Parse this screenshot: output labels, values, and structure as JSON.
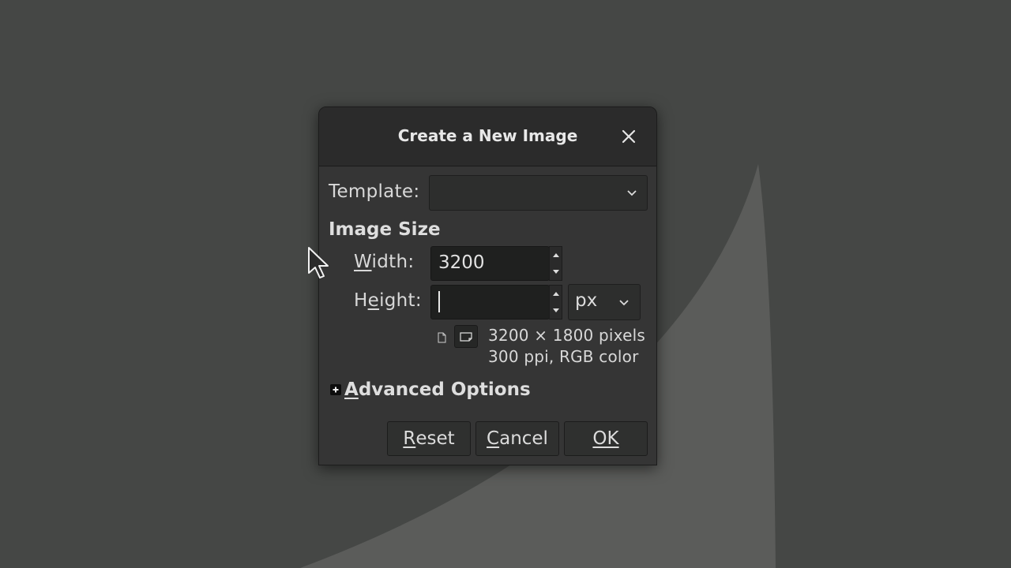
{
  "dialog": {
    "title": "Create a New Image",
    "template_label": "Template:",
    "template_value": "",
    "section_title": "Image Size",
    "width": {
      "label_first": "W",
      "label_rest": "idth:",
      "value": "3200"
    },
    "height": {
      "label_first": "H",
      "label_mid": "e",
      "label_rest": "ight:",
      "value": ""
    },
    "unit": "px",
    "info_line1": "3200 × 1800 pixels",
    "info_line2": "300 ppi, RGB color",
    "advanced": {
      "first": "A",
      "rest": "dvanced Options"
    },
    "buttons": {
      "reset": {
        "first": "R",
        "rest": "eset"
      },
      "cancel": {
        "first": "C",
        "rest": "ancel"
      },
      "ok": "OK"
    }
  },
  "icons": {
    "close": "close-icon",
    "dropdown": "chevron-down-icon",
    "spin_up": "arrow-up-icon",
    "spin_down": "arrow-down-icon",
    "portrait": "portrait-icon",
    "landscape": "landscape-icon",
    "expander": "expander-plus-icon",
    "cursor": "mouse-pointer-icon"
  },
  "colors": {
    "background": "#454745",
    "background_shape": "#5b5c5a",
    "dialog": "#353535",
    "titlebar": "#2b2b2b",
    "field": "#1f201f"
  }
}
